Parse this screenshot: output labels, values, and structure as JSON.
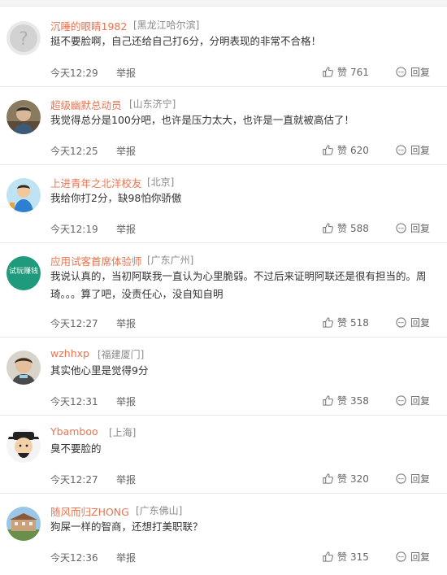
{
  "comments": [
    {
      "user": "沉睡的眼睛1982",
      "location": "[黑龙江哈尔滨]",
      "text": "挺不要脸啊，自己还给自己打6分，分明表现的非常不合格！",
      "time": "今天12:29",
      "report": "举报",
      "like_label": "赞",
      "likes": "761",
      "reply": "回复",
      "avatar_icon": "default-avatar-icon"
    },
    {
      "user": "超级幽默总动员",
      "location": "[山东济宁]",
      "text": "我觉得总分是100分吧，也许是压力太大，也许是一直就被高估了！",
      "time": "今天12:25",
      "report": "举报",
      "like_label": "赞",
      "likes": "620",
      "reply": "回复",
      "avatar_icon": "person-avatar-icon"
    },
    {
      "user": "上进青年之北洋校友",
      "location": "[北京]",
      "text": "我给你打2分，缺98怕你骄傲",
      "time": "今天12:19",
      "report": "举报",
      "like_label": "赞",
      "likes": "588",
      "reply": "回复",
      "avatar_icon": "cartoon-avatar-icon"
    },
    {
      "user": "应用试客首席体验师",
      "location": "[广东广州]",
      "text": "我说认真的，当初阿联我一直认为心里脆弱。不过后来证明阿联还是很有担当的。周琦。。。算了吧，没责任心，没自知自明",
      "time": "今天12:27",
      "report": "举报",
      "like_label": "赞",
      "likes": "518",
      "reply": "回复",
      "avatar_icon": "logo-avatar-icon",
      "avatar_text": "试玩赚钱"
    },
    {
      "user": "wzhhxp",
      "location": "[福建厦门]",
      "text": "其实他心里是觉得9分",
      "time": "今天12:31",
      "report": "举报",
      "like_label": "赞",
      "likes": "358",
      "reply": "回复",
      "avatar_icon": "person-avatar-icon"
    },
    {
      "user": "Ybamboo",
      "location": "[上海]",
      "text": "臭不要脸的",
      "time": "今天12:27",
      "report": "举报",
      "like_label": "赞",
      "likes": "320",
      "reply": "回复",
      "avatar_icon": "cartoon-face-avatar-icon"
    },
    {
      "user": "随风而归ZHONG",
      "location": "[广东佛山]",
      "text": "狗屎一样的智商，还想打美职联？",
      "time": "今天12:36",
      "report": "举报",
      "like_label": "赞",
      "likes": "315",
      "reply": "回复",
      "avatar_icon": "building-avatar-icon"
    }
  ],
  "colors": {
    "username": "#eb7350",
    "meta": "#666666",
    "location": "#8a8a8a",
    "divider": "#e8e8e8"
  }
}
